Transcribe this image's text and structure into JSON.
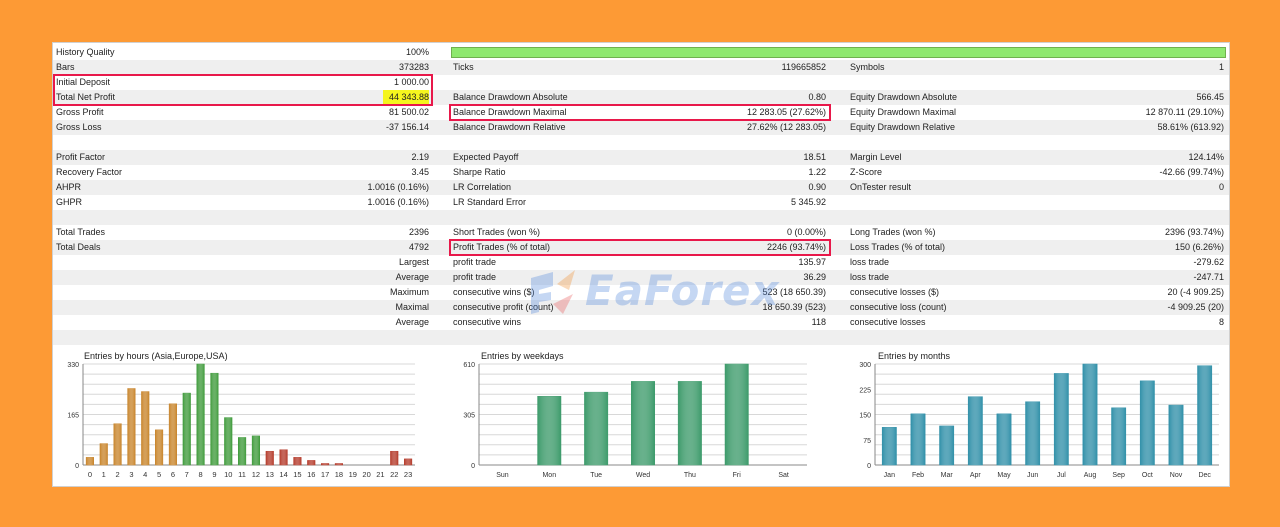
{
  "colors": {
    "page_bg": "#fd9a35",
    "row_alt": "#efefef",
    "quality_bar": "#8ee86e",
    "highlight_box": "#e8184a",
    "highlight_fill": "#f5f51e",
    "chart_weekday": "#3c9a6a",
    "chart_month": "#2f8fa8"
  },
  "stats": {
    "history_quality_label": "History Quality",
    "history_quality_value": "100%",
    "bars_label": "Bars",
    "bars_value": "373283",
    "ticks_label": "Ticks",
    "ticks_value": "119665852",
    "symbols_label": "Symbols",
    "symbols_value": "1",
    "initial_deposit_label": "Initial Deposit",
    "initial_deposit_value": "1 000.00",
    "total_net_profit_label": "Total Net Profit",
    "total_net_profit_value": "44 343.88",
    "balance_dd_abs_label": "Balance Drawdown Absolute",
    "balance_dd_abs_value": "0.80",
    "equity_dd_abs_label": "Equity Drawdown Absolute",
    "equity_dd_abs_value": "566.45",
    "gross_profit_label": "Gross Profit",
    "gross_profit_value": "81 500.02",
    "balance_dd_max_label": "Balance Drawdown Maximal",
    "balance_dd_max_value": "12 283.05 (27.62%)",
    "equity_dd_max_label": "Equity Drawdown Maximal",
    "equity_dd_max_value": "12 870.11 (29.10%)",
    "gross_loss_label": "Gross Loss",
    "gross_loss_value": "-37 156.14",
    "balance_dd_rel_label": "Balance Drawdown Relative",
    "balance_dd_rel_value": "27.62% (12 283.05)",
    "equity_dd_rel_label": "Equity Drawdown Relative",
    "equity_dd_rel_value": "58.61% (613.92)",
    "profit_factor_label": "Profit Factor",
    "profit_factor_value": "2.19",
    "expected_payoff_label": "Expected Payoff",
    "expected_payoff_value": "18.51",
    "margin_level_label": "Margin Level",
    "margin_level_value": "124.14%",
    "recovery_factor_label": "Recovery Factor",
    "recovery_factor_value": "3.45",
    "sharpe_label": "Sharpe Ratio",
    "sharpe_value": "1.22",
    "zscore_label": "Z-Score",
    "zscore_value": "-42.66 (99.74%)",
    "ahpr_label": "AHPR",
    "ahpr_value": "1.0016 (0.16%)",
    "lr_corr_label": "LR Correlation",
    "lr_corr_value": "0.90",
    "ontester_label": "OnTester result",
    "ontester_value": "0",
    "ghpr_label": "GHPR",
    "ghpr_value": "1.0016 (0.16%)",
    "lr_stderr_label": "LR Standard Error",
    "lr_stderr_value": "5 345.92",
    "total_trades_label": "Total Trades",
    "total_trades_value": "2396",
    "short_trades_label": "Short Trades (won %)",
    "short_trades_value": "0 (0.00%)",
    "long_trades_label": "Long Trades (won %)",
    "long_trades_value": "2396 (93.74%)",
    "total_deals_label": "Total Deals",
    "total_deals_value": "4792",
    "profit_trades_label": "Profit Trades (% of total)",
    "profit_trades_value": "2246 (93.74%)",
    "loss_trades_label": "Loss Trades (% of total)",
    "loss_trades_value": "150 (6.26%)",
    "largest_label": "Largest",
    "largest_profit_label": "profit trade",
    "largest_profit_value": "135.97",
    "largest_loss_label": "loss trade",
    "largest_loss_value": "-279.62",
    "average_label": "Average",
    "average_profit_label": "profit trade",
    "average_profit_value": "36.29",
    "average_loss_label": "loss trade",
    "average_loss_value": "-247.71",
    "maximum_label": "Maximum",
    "max_cons_wins_label": "consecutive wins ($)",
    "max_cons_wins_value": "523 (18 650.39)",
    "max_cons_losses_label": "consecutive losses ($)",
    "max_cons_losses_value": "20 (-4 909.25)",
    "maximal_label": "Maximal",
    "maximal_profit_label": "consecutive profit (count)",
    "maximal_profit_value": "18 650.39 (523)",
    "maximal_loss_label": "consecutive loss (count)",
    "maximal_loss_value": "-4 909.25 (20)",
    "average2_label": "Average",
    "avg_cons_wins_label": "consecutive wins",
    "avg_cons_wins_value": "118",
    "avg_cons_losses_label": "consecutive losses",
    "avg_cons_losses_value": "8"
  },
  "watermark": {
    "text": "EaForex",
    "logo_icon": "eaforex-logo-icon"
  },
  "chart_data": [
    {
      "type": "bar",
      "title": "Entries by hours (Asia,Europe,USA)",
      "categories": [
        "0",
        "1",
        "2",
        "3",
        "4",
        "5",
        "6",
        "7",
        "8",
        "9",
        "10",
        "11",
        "12",
        "13",
        "14",
        "15",
        "16",
        "17",
        "18",
        "19",
        "20",
        "21",
        "22",
        "23"
      ],
      "values": [
        25,
        70,
        135,
        250,
        240,
        115,
        200,
        235,
        330,
        300,
        155,
        90,
        95,
        45,
        50,
        25,
        15,
        5,
        5,
        0,
        0,
        0,
        45,
        20
      ],
      "ylim": [
        0,
        330
      ],
      "yticks": [
        "0",
        "165",
        "330"
      ]
    },
    {
      "type": "bar",
      "title": "Entries by weekdays",
      "categories": [
        "Sun",
        "Mon",
        "Tue",
        "Wed",
        "Thu",
        "Fri",
        "Sat"
      ],
      "values": [
        0,
        415,
        440,
        505,
        505,
        610,
        0
      ],
      "ylim": [
        0,
        610
      ],
      "yticks": [
        "0",
        "305",
        "610"
      ]
    },
    {
      "type": "bar",
      "title": "Entries by months",
      "categories": [
        "Jan",
        "Feb",
        "Mar",
        "Apr",
        "May",
        "Jun",
        "Jul",
        "Aug",
        "Sep",
        "Oct",
        "Nov",
        "Dec"
      ],
      "values": [
        112,
        152,
        116,
        203,
        152,
        188,
        272,
        300,
        170,
        250,
        178,
        295
      ],
      "ylim": [
        0,
        300
      ],
      "yticks": [
        "0",
        "75",
        "150",
        "225",
        "300"
      ]
    }
  ]
}
